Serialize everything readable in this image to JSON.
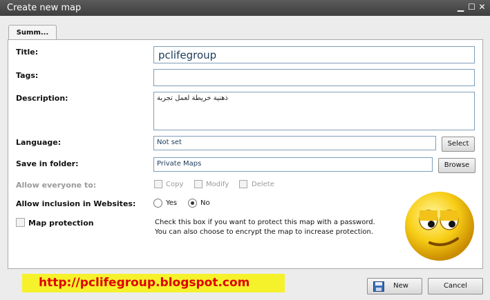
{
  "window": {
    "title": "Create new map"
  },
  "tab": {
    "label": "Summ..."
  },
  "form": {
    "title_label": "Title:",
    "title_value": "pclifegroup",
    "tags_label": "Tags:",
    "tags_value": "",
    "description_label": "Description:",
    "description_value": "ذهنية خريطة لعمل تجربة",
    "language_label": "Language:",
    "language_value": "Not set",
    "language_button": "Select",
    "folder_label": "Save in folder:",
    "folder_value": "Private Maps",
    "folder_button": "Browse",
    "allow_label": "Allow everyone to:",
    "allow_copy": "Copy",
    "allow_modify": "Modify",
    "allow_delete": "Delete",
    "inclusion_label": "Allow inclusion in Websites:",
    "yes_label": "Yes",
    "no_label": "No",
    "inclusion_selected": "No",
    "protection_label": "Map protection",
    "protection_help_1": "Check this box if you want to protect this map with a password.",
    "protection_help_2": "You can also choose to encrypt the map to increase protection."
  },
  "footer": {
    "link_text": "http://pclifegroup.blogspot.com",
    "new_button": "New",
    "cancel_button": "Cancel"
  },
  "icons": {
    "minimize": "minimize-icon",
    "maximize": "maximize-icon",
    "close": "close-icon",
    "mascot": "smiley-face-icon",
    "save": "floppy-disk-icon"
  }
}
